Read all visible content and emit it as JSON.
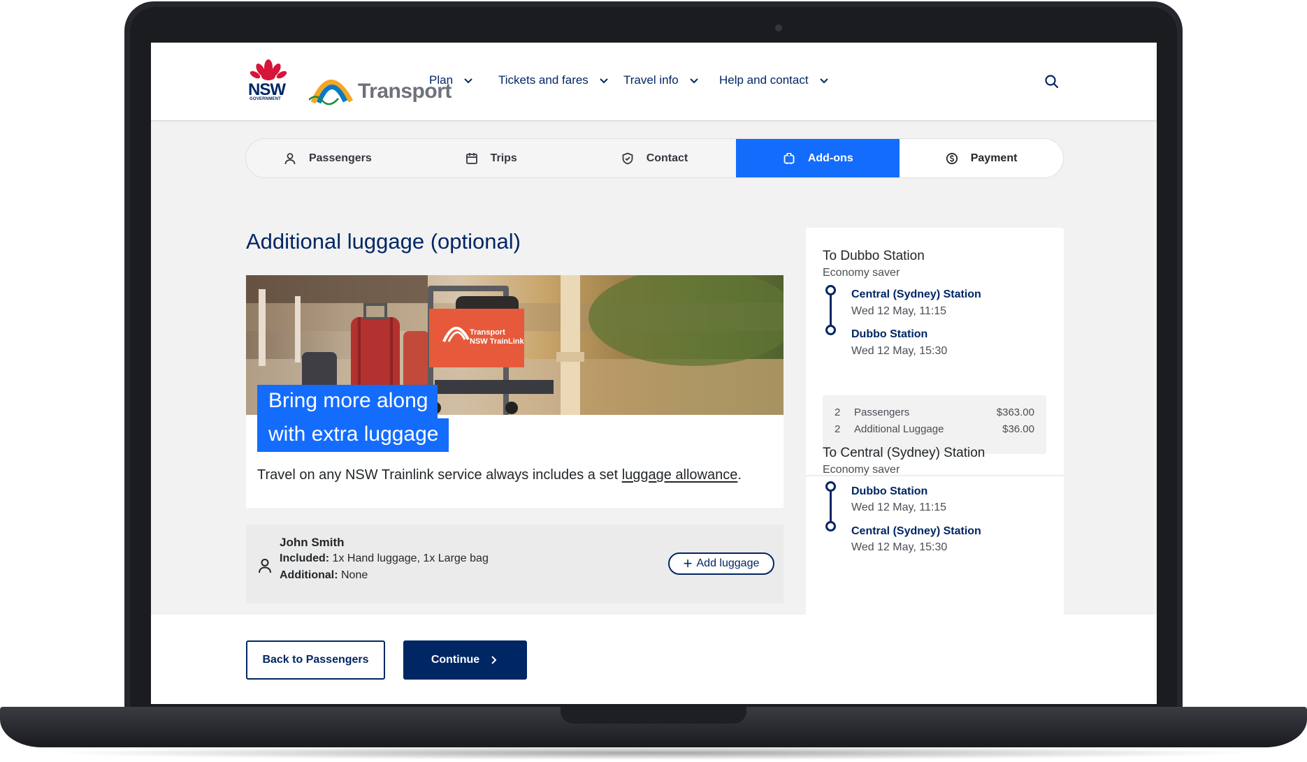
{
  "brand": {
    "nsw_text": "NSW",
    "nsw_sub": "GOVERNMENT",
    "transport_text": "Transport"
  },
  "nav": {
    "items": [
      {
        "label": "Plan"
      },
      {
        "label": "Tickets and fares"
      },
      {
        "label": "Travel info"
      },
      {
        "label": "Help and contact"
      }
    ]
  },
  "steps": [
    {
      "label": "Passengers",
      "icon": "person-icon"
    },
    {
      "label": "Trips",
      "icon": "calendar-icon"
    },
    {
      "label": "Contact",
      "icon": "shield-check-icon"
    },
    {
      "label": "Add-ons",
      "icon": "luggage-icon",
      "active": true
    },
    {
      "label": "Payment",
      "icon": "dollar-coin-icon"
    }
  ],
  "main": {
    "title": "Additional luggage (optional)",
    "hero": {
      "sign_line1": "Transport",
      "sign_line2": "NSW TrainLink",
      "caption_line1": "Bring more along",
      "caption_line2": "with extra luggage"
    },
    "info_text": "Travel on any NSW Trainlink service always includes a set ",
    "info_link": "luggage allowance",
    "info_end": "."
  },
  "passenger": {
    "name": "John Smith",
    "included_label": "Included:",
    "included_value": " 1x Hand luggage, 1x Large bag",
    "additional_label": "Additional:",
    "additional_value": " None",
    "add_button": "Add luggage"
  },
  "summary": {
    "outbound": {
      "title": "To Dubbo Station",
      "fare": "Economy saver",
      "from_station": "Central (Sydney) Station",
      "from_time": "Wed 12 May, 11:15",
      "to_station": "Dubbo Station",
      "to_time": "Wed 12 May, 15:30",
      "lines": [
        {
          "qty": "2",
          "label": "Passengers",
          "price": "$363.00"
        },
        {
          "qty": "2",
          "label": "Additional Luggage",
          "price": "$36.00"
        }
      ]
    },
    "return": {
      "title": "To Central (Sydney) Station",
      "fare": "Economy saver",
      "from_station": "Dubbo Station",
      "from_time": "Wed 12 May, 11:15",
      "to_station": "Central (Sydney) Station",
      "to_time": "Wed 12 May, 15:30"
    }
  },
  "footer": {
    "back_label": "Back to Passengers",
    "continue_label": "Continue"
  },
  "colors": {
    "navy": "#002664",
    "blue": "#146cfd",
    "nsw_red": "#d7153a"
  }
}
